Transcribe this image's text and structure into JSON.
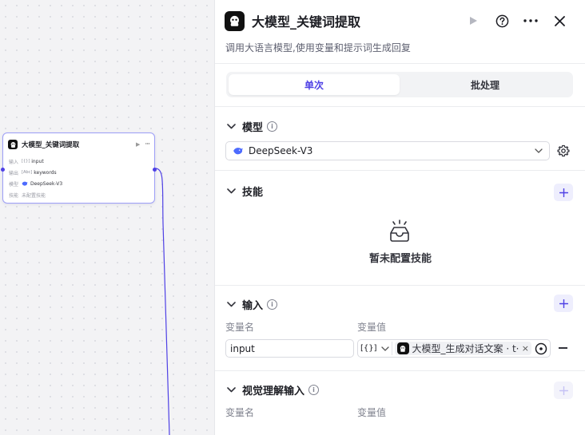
{
  "node": {
    "title": "大模型_关键词提取",
    "rows": [
      {
        "label": "输入",
        "value": "input",
        "kind": "var"
      },
      {
        "label": "输出",
        "value": "keywords",
        "kind": "var"
      },
      {
        "label": "模型",
        "value": "DeepSeek-V3",
        "kind": "model"
      },
      {
        "label": "技能",
        "value": "未配置技能",
        "kind": "text"
      }
    ]
  },
  "panel": {
    "title": "大模型_关键词提取",
    "description": "调用大语言模型,使用变量和提示词生成回复",
    "tabs": [
      {
        "label": "单次",
        "active": true
      },
      {
        "label": "批处理",
        "active": false
      }
    ],
    "model_section": {
      "title": "模型",
      "selected": "DeepSeek-V3"
    },
    "skills_section": {
      "title": "技能",
      "empty_text": "暂未配置技能"
    },
    "input_section": {
      "title": "输入",
      "col_name": "变量名",
      "col_value": "变量值",
      "rows": [
        {
          "name": "input",
          "type_label": "[{}]",
          "ref_text": "大模型_生成对话文案 · t···"
        }
      ]
    },
    "vision_section": {
      "title": "视觉理解输入",
      "col_name": "变量名",
      "col_value": "变量值"
    }
  },
  "colors": {
    "accent": "#4e40e5",
    "node_border": "#9d9ff7",
    "model_icon": "#4d6bfe"
  }
}
